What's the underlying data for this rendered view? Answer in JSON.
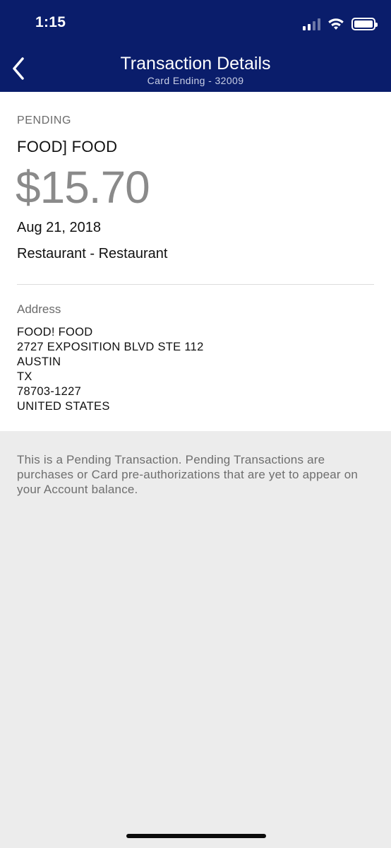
{
  "status_bar": {
    "time": "1:15"
  },
  "nav": {
    "title": "Transaction Details",
    "subtitle": "Card Ending - 32009"
  },
  "transaction": {
    "status": "PENDING",
    "merchant": "FOOD] FOOD",
    "amount": "$15.70",
    "date": "Aug 21, 2018",
    "category": "Restaurant - Restaurant"
  },
  "address": {
    "label": "Address",
    "lines": [
      "FOOD! FOOD",
      "2727 EXPOSITION BLVD STE 112",
      "AUSTIN",
      "TX",
      "78703-1227",
      "UNITED STATES"
    ]
  },
  "note": "This is a Pending Transaction. Pending Transactions are purchases or Card pre-authorizations that are yet to appear on your Account balance.",
  "colors": {
    "header_bg": "#0a1d6b",
    "background": "#ececec",
    "amount": "#8a8a8a"
  },
  "icons": {
    "back": "chevron-left-icon",
    "signal": "cellular-signal-icon",
    "wifi": "wifi-icon",
    "battery": "battery-icon"
  }
}
